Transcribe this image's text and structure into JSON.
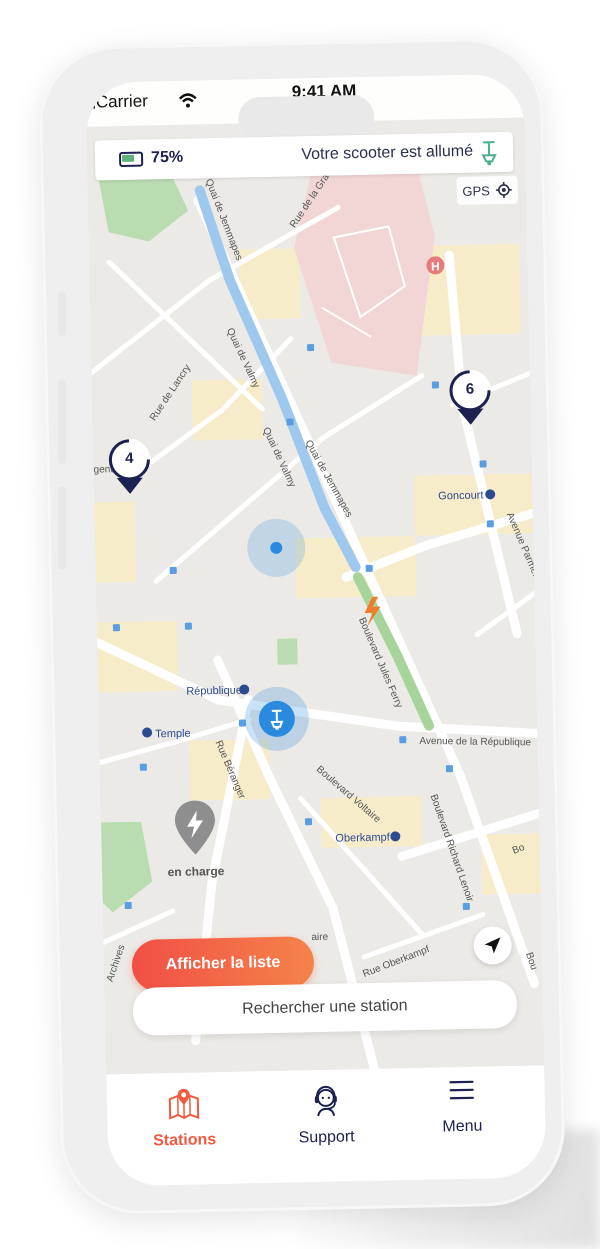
{
  "status_bar": {
    "carrier": "Carrier",
    "time": "9:41 AM"
  },
  "info_bar": {
    "battery": "75%",
    "scooter_status": "Votre scooter est allumé"
  },
  "gps_label": "GPS",
  "map": {
    "streets": [
      "Quai de Jemmapes",
      "Quai de Jemmapes",
      "Quai de Valmy",
      "Quai de Valmy",
      "Rue de la Grange",
      "Rue de Lancry",
      "Boulevard Jules Ferry",
      "Avenue Parmentier",
      "Avenue de la République",
      "Boulevard Voltaire",
      "Rue Béranger",
      "Boulevard Richard Lenoir",
      "Rue Oberkampf",
      "Archives",
      "gent",
      "Bou",
      "Bo",
      "aire"
    ],
    "metro": [
      "Goncourt",
      "République",
      "Temple",
      "Oberkampf"
    ],
    "hospital_letter": "H",
    "station_pins": [
      {
        "count": "4"
      },
      {
        "count": "6"
      }
    ],
    "charging_label": "en charge"
  },
  "actions": {
    "show_list": "Afficher la liste",
    "search_placeholder": "Rechercher une station"
  },
  "tabs": [
    {
      "label": "Stations",
      "icon": "map-icon",
      "active": true
    },
    {
      "label": "Support",
      "icon": "support-agent-icon",
      "active": false
    },
    {
      "label": "Menu",
      "icon": "hamburger-menu-icon",
      "active": false
    }
  ],
  "colors": {
    "accent": "#f05a3f",
    "navy": "#1b2150",
    "pin_blue": "#2a8bde",
    "park_green": "#b9dcb0",
    "canal_blue": "#9fc8ef",
    "hospital_pink": "#f2d6d6"
  }
}
